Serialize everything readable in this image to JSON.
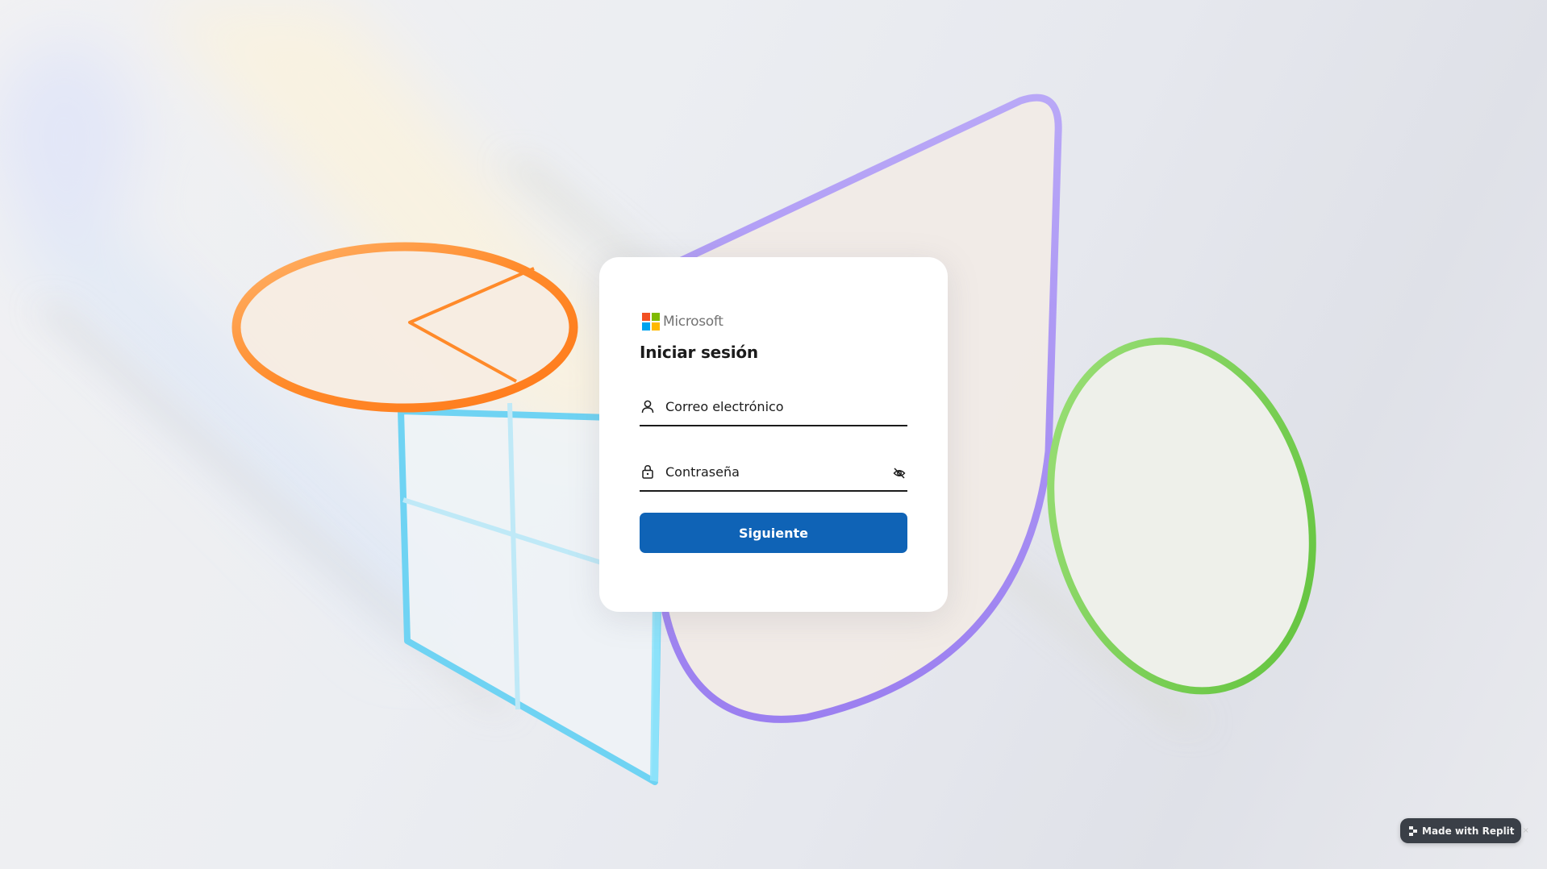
{
  "brand": {
    "name": "Microsoft",
    "logo_colors": [
      "#f25022",
      "#7fba00",
      "#00a4ef",
      "#ffb900"
    ]
  },
  "login": {
    "title": "Iniciar sesión",
    "email_placeholder": "Correo electrónico",
    "password_placeholder": "Contraseña",
    "next_label": "Siguiente"
  },
  "icons": {
    "email": "user-icon",
    "password": "lock-icon",
    "visibility": "eye-off-icon"
  },
  "colors": {
    "primary": "#0f63b6",
    "text": "#1b1b1b"
  },
  "badge": {
    "label": "Made with Replit",
    "close": "×"
  }
}
